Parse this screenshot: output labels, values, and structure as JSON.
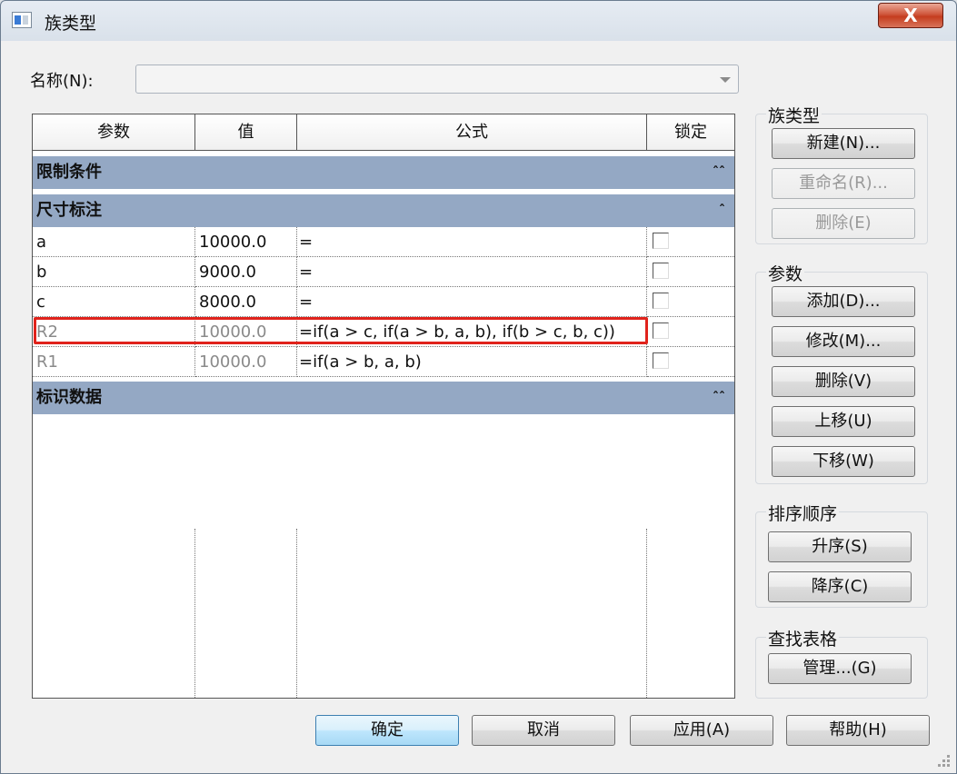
{
  "window": {
    "title": "族类型",
    "close_symbol": "X"
  },
  "name_field": {
    "label": "名称(N):",
    "value": ""
  },
  "table": {
    "headers": {
      "param": "参数",
      "value": "值",
      "formula": "公式",
      "lock": "锁定"
    },
    "groups": {
      "constraints": "限制条件",
      "dimensions": "尺寸标注",
      "identity": "标识数据"
    },
    "rows": [
      {
        "name": "a",
        "value": "10000.0",
        "formula": "=",
        "locked": false
      },
      {
        "name": "b",
        "value": "9000.0",
        "formula": "=",
        "locked": false
      },
      {
        "name": "c",
        "value": "8000.0",
        "formula": "=",
        "locked": false
      },
      {
        "name": "R2",
        "value": "10000.0",
        "formula": "=if(a > c, if(a > b, a, b), if(b > c, b, c))",
        "locked": false
      },
      {
        "name": "R1",
        "value": "10000.0",
        "formula": "=if(a > b, a, b)",
        "locked": false
      }
    ]
  },
  "family_types": {
    "title": "族类型",
    "new": "新建(N)...",
    "rename": "重命名(R)...",
    "delete": "删除(E)"
  },
  "parameters": {
    "title": "参数",
    "add": "添加(D)...",
    "modify": "修改(M)...",
    "delete": "删除(V)",
    "move_up": "上移(U)",
    "move_down": "下移(W)"
  },
  "sort": {
    "title": "排序顺序",
    "ascending": "升序(S)",
    "descending": "降序(C)"
  },
  "lookup": {
    "title": "查找表格",
    "manage": "管理...(G)"
  },
  "footer": {
    "ok": "确定",
    "cancel": "取消",
    "apply": "应用(A)",
    "help": "帮助(H)"
  },
  "colors": {
    "group_header": "#94a8c4",
    "highlight": "#e0231c"
  }
}
